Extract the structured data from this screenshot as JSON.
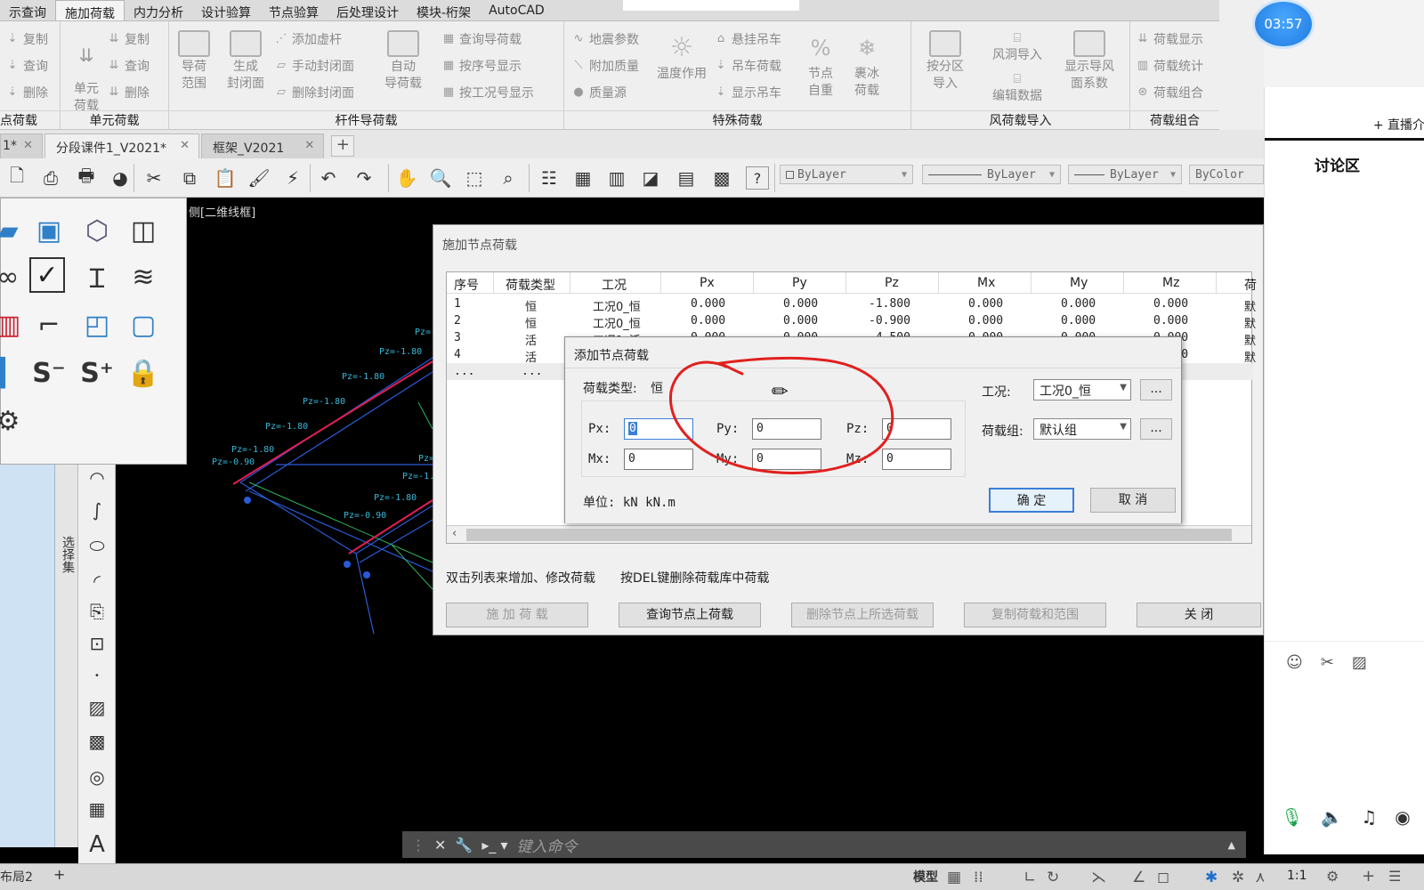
{
  "menu": [
    "示查询",
    "施加荷载",
    "内力分析",
    "设计验算",
    "节点验算",
    "后处理设计",
    "模块-桁架",
    "AutoCAD"
  ],
  "menu_active_index": 1,
  "ribbon": {
    "groups": [
      {
        "title": "点荷载"
      },
      {
        "title": "单元荷载"
      },
      {
        "title": "杆件导荷载"
      },
      {
        "title": "特殊荷载"
      },
      {
        "title": "风荷载导入"
      },
      {
        "title": "荷载组合"
      }
    ],
    "items": {
      "node_copy": "复制",
      "node_query": "查询",
      "node_delete": "删除",
      "elem_load": "单元\n荷载",
      "elem_copy": "复制",
      "elem_query": "查询",
      "elem_delete": "删除",
      "guide_range": "导荷\n范围",
      "gen_closed": "生成\n封闭面",
      "add_virtual": "添加虚杆",
      "manual_closed": "手动封闭面",
      "delete_closed": "删除封闭面",
      "auto_guide": "自动\n导荷载",
      "query_guide": "查询导荷载",
      "by_order": "按序号显示",
      "by_case": "按工况号显示",
      "seismic": "地震参数",
      "extra_mass": "附加质量",
      "mass_source": "质量源",
      "temperature": "温度作用",
      "crane_hang": "悬挂吊车",
      "crane_load": "吊车荷载",
      "show_crane": "显示吊车",
      "node_selfweight": "节点\n自重",
      "ice_load": "裹冰\n荷载",
      "zone_import": "按分区\n导入",
      "wind_hole": "风洞导入",
      "edit_data": "编辑数据",
      "show_wind_coef": "显示导风\n面系数",
      "load_display": "荷载显示",
      "load_stats": "荷载统计",
      "load_combo": "荷载组合"
    }
  },
  "tabs": [
    {
      "label": "1*"
    },
    {
      "label": "分段课件1_V2021*"
    },
    {
      "label": "框架_V2021"
    }
  ],
  "toolbar": {
    "layer": "ByLayer",
    "linetype": "ByLayer",
    "lineweight": "ByLayer",
    "color": "ByColor"
  },
  "canvas": {
    "view_label": "侧[二维线框]",
    "select_set_tab": "选择集"
  },
  "command": {
    "placeholder": "键入命令"
  },
  "status": {
    "layout_tab": "布局2",
    "model_label": "模型",
    "scale": "1:1"
  },
  "dialog_main": {
    "title": "施加节点荷载",
    "columns": [
      "序号",
      "荷载类型",
      "工况",
      "Px",
      "Py",
      "Pz",
      "Mx",
      "My",
      "Mz",
      "荷"
    ],
    "rows": [
      [
        "1",
        "恒",
        "工况0_恒",
        "0.000",
        "0.000",
        "-1.800",
        "0.000",
        "0.000",
        "0.000",
        "默"
      ],
      [
        "2",
        "恒",
        "工况0_恒",
        "0.000",
        "0.000",
        "-0.900",
        "0.000",
        "0.000",
        "0.000",
        "默"
      ],
      [
        "3",
        "活",
        "工况1_活",
        "0.000",
        "0.000",
        "-4.500",
        "0.000",
        "0.000",
        "0.000",
        "默"
      ],
      [
        "4",
        "活",
        "",
        "",
        "",
        "",
        "",
        "",
        "0.000",
        "默"
      ],
      [
        "...",
        "...",
        "",
        "",
        "",
        "",
        "",
        "",
        "",
        ""
      ]
    ],
    "hint_dblclick": "双击列表来增加、修改荷载",
    "hint_del": "按DEL键删除荷载库中荷载",
    "buttons": {
      "apply": "施 加 荷 载",
      "query": "查询节点上荷载",
      "delete_selected": "删除节点上所选荷载",
      "copy_range": "复制荷载和范围",
      "close": "关    闭"
    }
  },
  "dialog_add": {
    "title": "添加节点荷载",
    "load_type_label": "荷载类型:",
    "load_type_value": "恒",
    "case_label": "工况:",
    "case_value": "工况0_恒",
    "group_label": "荷载组:",
    "group_value": "默认组",
    "ellipsis": "...",
    "fields": {
      "px_label": "Px:",
      "px": "0",
      "py_label": "Py:",
      "py": "0",
      "pz_label": "Pz:",
      "pz": "0",
      "mx_label": "Mx:",
      "mx": "0",
      "my_label": "My:",
      "my": "0",
      "mz_label": "Mz:",
      "mz": "0"
    },
    "unit": "单位: kN kN.m",
    "ok": "确  定",
    "cancel": "取  消"
  },
  "right_panel": {
    "live_intro": "+ 直播介",
    "discussion": "讨论区"
  },
  "timer": "03:57",
  "colors": {
    "accent_blue": "#3c7fd6",
    "annotation_red": "#e0201e",
    "canvas_bg": "#000000"
  }
}
